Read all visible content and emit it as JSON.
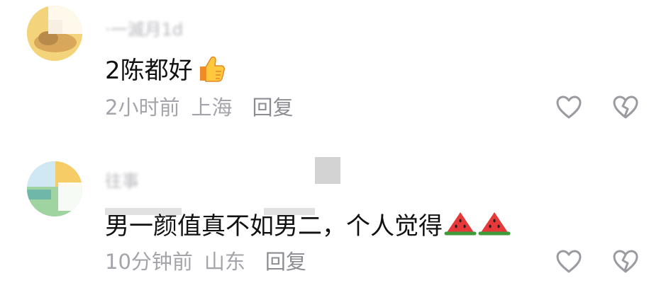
{
  "comments": [
    {
      "username": "·一滅月1d",
      "text": "2陈都好",
      "emojis": [
        "thumbs-up-icon"
      ],
      "time": "2小时前",
      "location": "上海",
      "reply": "回复"
    },
    {
      "username": "往事",
      "text": "男一颜值真不如男二，个人觉得",
      "emojis": [
        "watermelon-icon",
        "watermelon-icon"
      ],
      "time": "10分钟前",
      "location": "山东",
      "reply": "回复"
    }
  ],
  "colors": {
    "text": "#111111",
    "meta": "#a4a4ab",
    "reply": "#8c8c93",
    "icon": "#9a9aa0"
  }
}
